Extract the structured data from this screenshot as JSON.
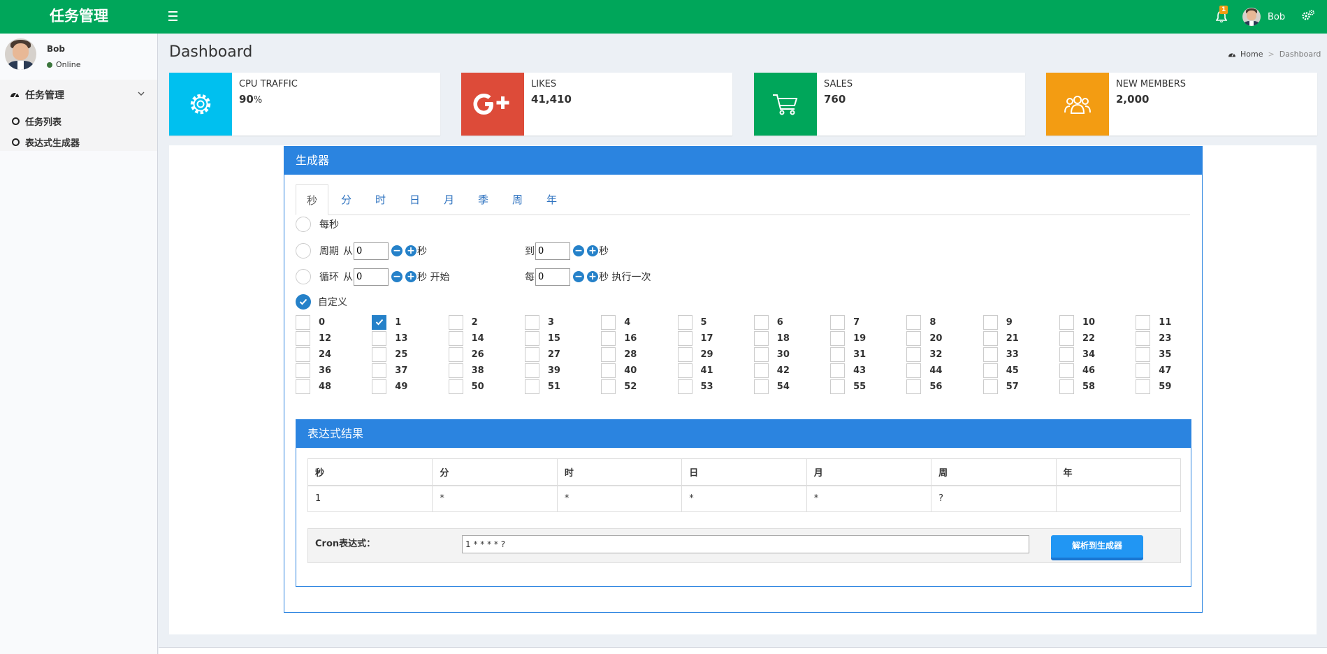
{
  "app": {
    "title": "任务管理"
  },
  "header": {
    "notification_count": "1",
    "user_name": "Bob"
  },
  "sidebar": {
    "user": {
      "name": "Bob",
      "status": "Online"
    },
    "menu": {
      "label": "任务管理",
      "items": [
        {
          "label": "任务列表"
        },
        {
          "label": "表达式生成器"
        }
      ]
    }
  },
  "page": {
    "title": "Dashboard",
    "breadcrumb": [
      "Home",
      "Dashboard"
    ]
  },
  "info_boxes": [
    {
      "label": "CPU TRAFFIC",
      "value": "90",
      "unit": "%",
      "color": "#00c0ef",
      "icon": "gear-icon"
    },
    {
      "label": "LIKES",
      "value": "41,410",
      "unit": "",
      "color": "#dd4b39",
      "icon": "google-plus-icon"
    },
    {
      "label": "SALES",
      "value": "760",
      "unit": "",
      "color": "#00a65a",
      "icon": "shopping-cart-icon"
    },
    {
      "label": "NEW MEMBERS",
      "value": "2,000",
      "unit": "",
      "color": "#f39c12",
      "icon": "users-icon"
    }
  ],
  "generator": {
    "title": "生成器",
    "tabs": [
      "秒",
      "分",
      "时",
      "日",
      "月",
      "季",
      "周",
      "年"
    ],
    "active_tab": "秒",
    "options": {
      "every": {
        "label": "每秒"
      },
      "period": {
        "label": "周期",
        "from_label": "从",
        "from_value": "0",
        "unit": "秒",
        "to_label": "到",
        "to_value": "0",
        "to_unit": "秒"
      },
      "loop": {
        "label": "循环",
        "from_label": "从",
        "from_value": "0",
        "unit": "秒 开始",
        "every_label": "每",
        "every_value": "0",
        "every_unit": "秒 执行一次"
      },
      "custom": {
        "label": "自定义",
        "selected": true
      }
    },
    "seconds": [
      "0",
      "1",
      "2",
      "3",
      "4",
      "5",
      "6",
      "7",
      "8",
      "9",
      "10",
      "11",
      "12",
      "13",
      "14",
      "15",
      "16",
      "17",
      "18",
      "19",
      "20",
      "21",
      "22",
      "23",
      "24",
      "25",
      "26",
      "27",
      "28",
      "29",
      "30",
      "31",
      "32",
      "33",
      "34",
      "35",
      "36",
      "37",
      "38",
      "39",
      "40",
      "41",
      "42",
      "43",
      "44",
      "45",
      "46",
      "47",
      "48",
      "49",
      "50",
      "51",
      "52",
      "53",
      "54",
      "55",
      "56",
      "57",
      "58",
      "59"
    ],
    "checked_seconds": [
      "1"
    ]
  },
  "result": {
    "title": "表达式结果",
    "headers": [
      "秒",
      "分",
      "时",
      "日",
      "月",
      "周",
      "年"
    ],
    "values": [
      "1",
      "*",
      "*",
      "*",
      "*",
      "?",
      ""
    ],
    "cron_label": "Cron表达式：",
    "cron_value": "1 * * * * ?",
    "parse_button": "解析到生成器"
  },
  "colors": {
    "header_green": "#00a65a",
    "panel_blue": "#2b84e0",
    "radio_blue": "#2581c9"
  }
}
